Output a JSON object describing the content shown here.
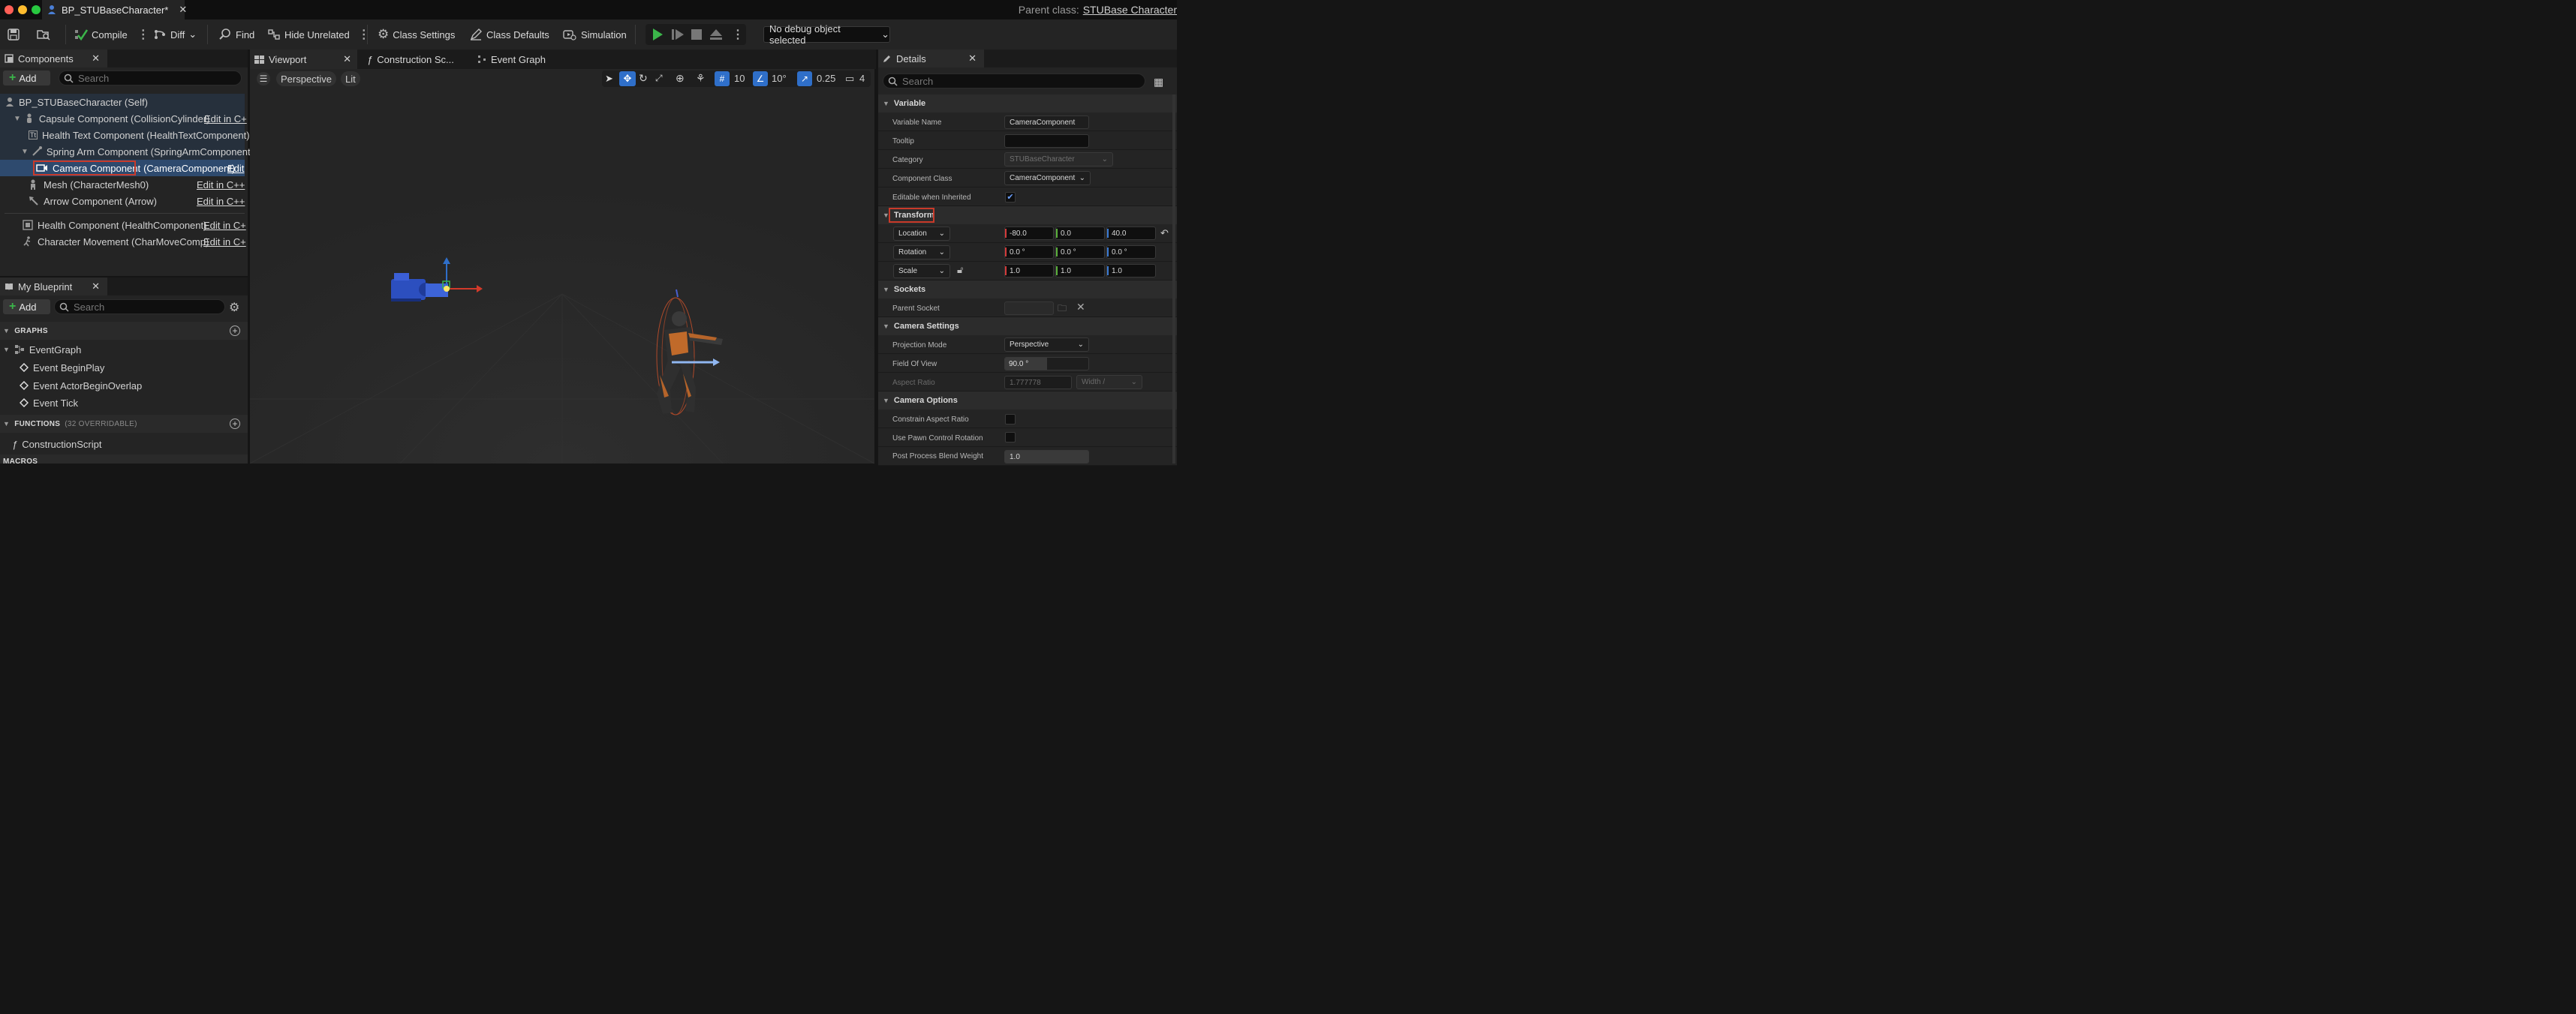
{
  "window": {
    "tab_title": "BP_STUBaseCharacter*",
    "parent_class_label": "Parent class:",
    "parent_class_value": "STUBase Character"
  },
  "toolbar": {
    "compile": "Compile",
    "diff": "Diff",
    "find": "Find",
    "hide_unrelated": "Hide Unrelated",
    "class_settings": "Class Settings",
    "class_defaults": "Class Defaults",
    "simulation": "Simulation",
    "debug_object": "No debug object selected"
  },
  "components": {
    "tab_title": "Components",
    "add": "Add",
    "search_placeholder": "Search",
    "items": [
      {
        "label": "BP_STUBaseCharacter (Self)",
        "edit": ""
      },
      {
        "label": "Capsule Component (CollisionCylinder)",
        "edit": "Edit in C+"
      },
      {
        "label": "Health Text Component (HealthTextComponent)",
        "edit": ""
      },
      {
        "label": "Spring Arm Component (SpringArmComponent)",
        "edit": ""
      },
      {
        "label": "Camera Component",
        "label_rest": "(CameraComponent)",
        "edit": "Edit"
      },
      {
        "label": "Mesh (CharacterMesh0)",
        "edit": "Edit in C++"
      },
      {
        "label": "Arrow Component (Arrow)",
        "edit": "Edit in C++"
      },
      {
        "label": "Health Component (HealthComponent)",
        "edit": "Edit in C+"
      },
      {
        "label": "Character Movement (CharMoveComp)",
        "edit": "Edit in C+"
      }
    ]
  },
  "my_blueprint": {
    "tab_title": "My Blueprint",
    "add": "Add",
    "search_placeholder": "Search",
    "graphs_header": "GRAPHS",
    "event_graph": "EventGraph",
    "events": [
      "Event BeginPlay",
      "Event ActorBeginOverlap",
      "Event Tick"
    ],
    "functions_header": "FUNCTIONS",
    "functions_count": "(32 OVERRIDABLE)",
    "construction_script": "ConstructionScript",
    "macros_header": "MACROS"
  },
  "editor_tabs": {
    "viewport": "Viewport",
    "construction": "Construction Sc...",
    "event_graph": "Event Graph"
  },
  "viewport": {
    "perspective": "Perspective",
    "lit": "Lit",
    "grid_snap": "10",
    "rotation_snap": "10°",
    "scale_snap": "0.25",
    "camera_speed": "4"
  },
  "details": {
    "tab_title": "Details",
    "search_placeholder": "Search",
    "variable_header": "Variable",
    "variable_name_label": "Variable Name",
    "variable_name_value": "CameraComponent",
    "tooltip_label": "Tooltip",
    "tooltip_value": "",
    "category_label": "Category",
    "category_value": "STUBaseCharacter",
    "component_class_label": "Component Class",
    "component_class_value": "CameraComponent",
    "editable_label": "Editable when Inherited",
    "editable_checked": true,
    "transform_header": "Transform",
    "location_label": "Location",
    "location": [
      "-80.0",
      "0.0",
      "40.0"
    ],
    "rotation_label": "Rotation",
    "rotation": [
      "0.0 °",
      "0.0 °",
      "0.0 °"
    ],
    "scale_label": "Scale",
    "scale": [
      "1.0",
      "1.0",
      "1.0"
    ],
    "sockets_header": "Sockets",
    "parent_socket_label": "Parent Socket",
    "camera_settings_header": "Camera Settings",
    "projection_mode_label": "Projection Mode",
    "projection_mode_value": "Perspective",
    "fov_label": "Field Of View",
    "fov_value": "90.0 °",
    "aspect_ratio_label": "Aspect Ratio",
    "aspect_ratio_value": "1.777778",
    "aspect_ratio_axis": "Width /",
    "camera_options_header": "Camera Options",
    "constrain_label": "Constrain Aspect Ratio",
    "pawn_control_label": "Use Pawn Control Rotation",
    "blend_weight_label": "Post Process Blend Weight",
    "blend_weight_value": "1.0"
  },
  "colors": {
    "accent_blue": "#2f6fc9",
    "play_green": "#3bb54a",
    "highlight_red": "#c93a2a",
    "selection": "#2e4a6e"
  }
}
